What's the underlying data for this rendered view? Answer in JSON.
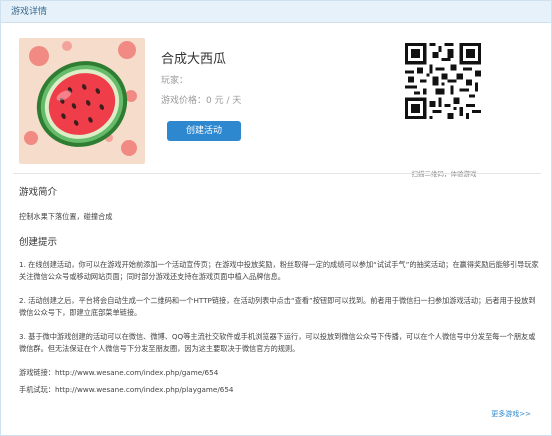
{
  "header": {
    "title": "游戏详情"
  },
  "game": {
    "title": "合成大西瓜",
    "player_label": "玩家：",
    "price_label": "游戏价格：",
    "price_value": "0 元 / 天",
    "create_button": "创建活动",
    "qr_caption": "扫描二维码，体验游戏"
  },
  "intro": {
    "heading": "游戏简介",
    "text": "控制水果下落位置，碰撞合成"
  },
  "tips": {
    "heading": "创建提示",
    "items": [
      "1. 在线创建活动，你可以在游戏开始前添加一个活动宣传页；在游戏中投放奖励，粉丝取得一定的成绩可以参加“试试手气”的抽奖活动；在赢得奖励后能够引导玩家关注微信公众号或移动网站页面；同时部分游戏还支持在游戏页面中植入品牌信息。",
      "2. 活动创建之后，平台将会自动生成一个二维码和一个HTTP链接，在活动列表中点击“查看”按钮即可以找到。前者用于微信扫一扫参加游戏活动；后者用于投放到微信公众号下，即建立底部菜单链接。",
      "3. 基于微中游戏创建的活动可以在微信、微博、QQ等主流社交软件或手机浏览器下运行，可以投放到微信公众号下传播，可以在个人微信号中分发至每一个朋友或微信群。但无法保证在个人微信号下分发至朋友圈，因为这主要取决于微信官方的规则。"
    ]
  },
  "links": {
    "game_link": "游戏链接：http://www.wesane.com/index.php/game/654",
    "mobile_link": "手机试玩：http://www.wesane.com/index.php/playgame/654"
  },
  "more_games": "更多游戏>>",
  "colors": {
    "accent": "#2d88cf",
    "header_bg": "#e6f1fa",
    "watermelon_bg": "#f6dccb"
  },
  "icons": {
    "thumbnail": "watermelon-image",
    "qr": "qr-code-image"
  }
}
